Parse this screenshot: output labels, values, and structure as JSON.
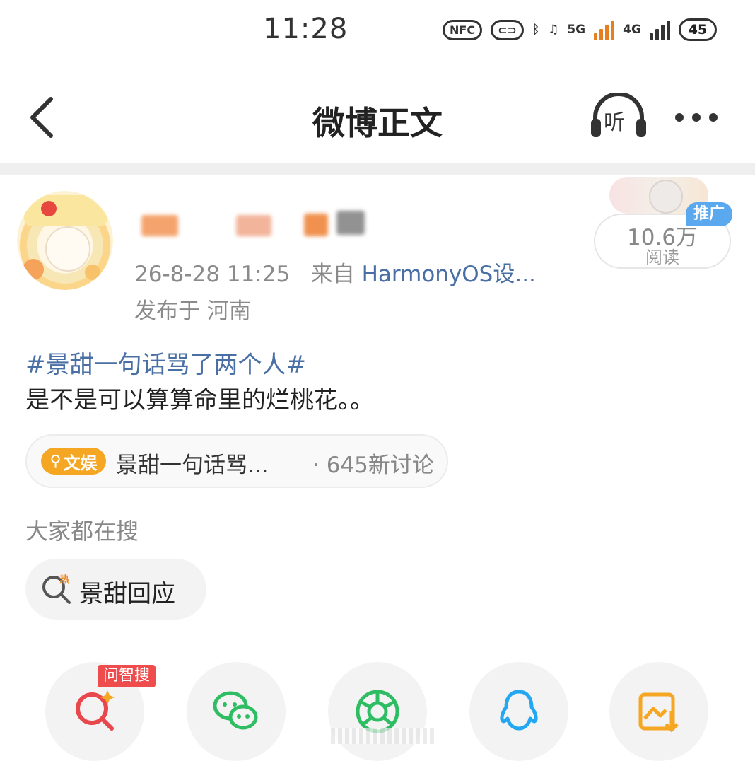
{
  "status_bar": {
    "time": "11:28",
    "nfc": "NFC",
    "network_5g": "5G",
    "network_4g": "4G",
    "battery": "45"
  },
  "nav": {
    "title": "微博正文",
    "listen_label": "听"
  },
  "post": {
    "time": "26-8-28 11:25",
    "from_label": "来自",
    "source": "HarmonyOS设...",
    "location": "发布于 河南",
    "hashtag": "#景甜一句话骂了两个人#",
    "content": "是不是可以算算命里的烂桃花。。"
  },
  "read_ad": {
    "count": "10.6万",
    "label": "阅读",
    "tag": "推广"
  },
  "topic": {
    "badge": "文娱",
    "text": "景甜一句话骂...",
    "count": "· 645新讨论"
  },
  "search": {
    "label": "大家都在搜",
    "hot_badge": "热",
    "hot_item": "景甜回应"
  },
  "share": {
    "ask_badge": "问智搜",
    "items": [
      "smart-search",
      "wechat",
      "moments",
      "qq",
      "save-image"
    ]
  },
  "colors": {
    "link": "#4a6fa5",
    "badge_orange": "#f5a623",
    "promo_blue": "#5aa9ee",
    "ask_red": "#ef4d4d"
  }
}
